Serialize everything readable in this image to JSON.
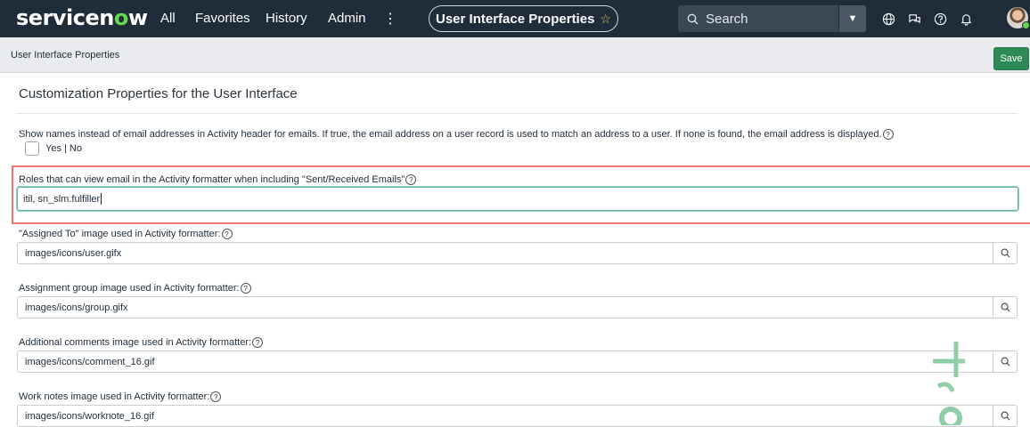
{
  "nav": {
    "logo_prefix": "servicen",
    "logo_o": "o",
    "logo_suffix": "w",
    "links": [
      "All",
      "Favorites",
      "History",
      "Admin"
    ],
    "more_glyph": "⋮",
    "page_title": "User Interface Properties",
    "favorite_glyph": "☆",
    "search_placeholder": "Search",
    "icons": [
      "globe-icon",
      "chat-icon",
      "help-icon",
      "bell-icon"
    ]
  },
  "subheader": {
    "title": "User Interface Properties",
    "save_label": "Save"
  },
  "content": {
    "section_title": "Customization Properties for the User Interface",
    "properties": [
      {
        "label": "Show names instead of email addresses in Activity header for emails. If true, the email address on a user record is used to match an address to a user. If none is found, the email address is displayed.",
        "type": "checkbox",
        "option_label": "Yes | No"
      },
      {
        "label": "Roles that can view email in the Activity formatter when including \"Sent/Received Emails\"",
        "type": "text",
        "value": "itil, sn_slm.fulfiller"
      },
      {
        "label": "\"Assigned To\" image used in Activity formatter:",
        "type": "reference",
        "value": "images/icons/user.gifx"
      },
      {
        "label": "Assignment group image used in Activity formatter:",
        "type": "reference",
        "value": "images/icons/group.gifx"
      },
      {
        "label": "Additional comments image used in Activity formatter:",
        "type": "reference",
        "value": "images/icons/comment_16.gif"
      },
      {
        "label": "Work notes image used in Activity formatter:",
        "type": "reference",
        "value": "images/icons/worknote_16.gif"
      }
    ],
    "help_glyph": "?"
  },
  "colors": {
    "nav_bg": "#1f2d3b",
    "accent_green": "#62d84e",
    "save_green": "#2e8b57",
    "highlight_red": "#f07171",
    "focus_teal": "#5fb3a3"
  }
}
